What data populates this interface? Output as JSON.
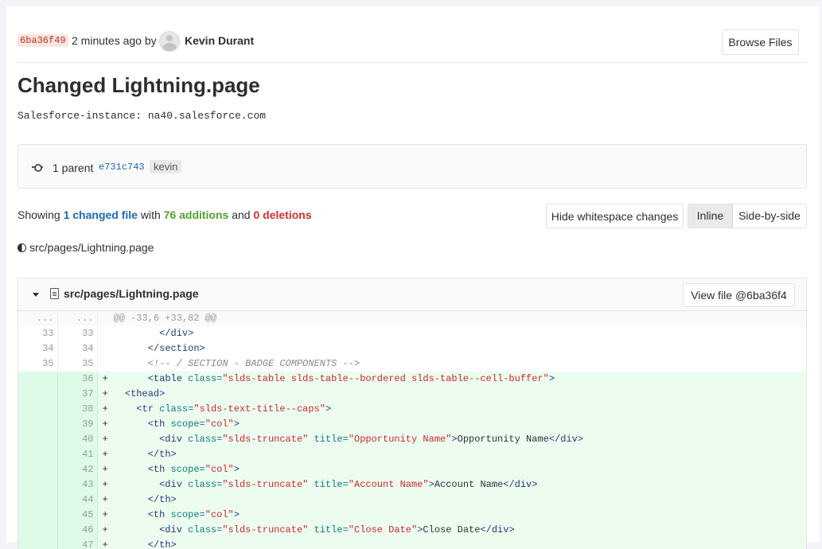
{
  "commit": {
    "sha": "6ba36f49",
    "time_text": "2 minutes ago by",
    "author": "Kevin Durant",
    "browse_label": "Browse Files",
    "title": "Changed Lightning.page",
    "description": "Salesforce-instance: na40.salesforce.com",
    "parents_text": "1 parent",
    "parent_sha": "e731c743",
    "branch": "kevin"
  },
  "summary": {
    "prefix": "Showing ",
    "changed": "1 changed file",
    "with": " with ",
    "additions": "76 additions",
    "and": " and ",
    "deletions": "0 deletions"
  },
  "toolbar": {
    "whitespace_label": "Hide whitespace changes",
    "inline_label": "Inline",
    "side_label": "Side-by-side"
  },
  "file_tree": {
    "path": "src/pages/Lightning.page"
  },
  "diff_file": {
    "name": "src/pages/Lightning.page",
    "view_label": "View file @6ba36f4",
    "hunk_header": "@@ -33,6 +33,82 @@",
    "hunk_ellipsis": "...",
    "lines": [
      {
        "old": "33",
        "new": "33",
        "sign": "",
        "type": "ctx",
        "tokens": [
          [
            "txt",
            "        "
          ],
          [
            "tag",
            "</div>"
          ]
        ]
      },
      {
        "old": "34",
        "new": "34",
        "sign": "",
        "type": "ctx",
        "tokens": [
          [
            "txt",
            "      "
          ],
          [
            "tag",
            "</section>"
          ]
        ]
      },
      {
        "old": "35",
        "new": "35",
        "sign": "",
        "type": "ctx",
        "tokens": [
          [
            "txt",
            "      "
          ],
          [
            "cmt",
            "<!-- / SECTION - BADGE COMPONENTS -->"
          ]
        ]
      },
      {
        "old": "",
        "new": "36",
        "sign": "+",
        "type": "add",
        "tokens": [
          [
            "txt",
            "      "
          ],
          [
            "tag",
            "<table "
          ],
          [
            "attr",
            "class="
          ],
          [
            "str",
            "\"slds-table slds-table--bordered slds-table--cell-buffer\""
          ],
          [
            "tag",
            ">"
          ]
        ]
      },
      {
        "old": "",
        "new": "37",
        "sign": "+",
        "type": "add",
        "tokens": [
          [
            "txt",
            "  "
          ],
          [
            "tag",
            "<thead>"
          ]
        ]
      },
      {
        "old": "",
        "new": "38",
        "sign": "+",
        "type": "add",
        "tokens": [
          [
            "txt",
            "    "
          ],
          [
            "tag",
            "<tr "
          ],
          [
            "attr",
            "class="
          ],
          [
            "str",
            "\"slds-text-title--caps\""
          ],
          [
            "tag",
            ">"
          ]
        ]
      },
      {
        "old": "",
        "new": "39",
        "sign": "+",
        "type": "add",
        "tokens": [
          [
            "txt",
            "      "
          ],
          [
            "tag",
            "<th "
          ],
          [
            "attr",
            "scope="
          ],
          [
            "str",
            "\"col\""
          ],
          [
            "tag",
            ">"
          ]
        ]
      },
      {
        "old": "",
        "new": "40",
        "sign": "+",
        "type": "add",
        "tokens": [
          [
            "txt",
            "        "
          ],
          [
            "tag",
            "<div "
          ],
          [
            "attr",
            "class="
          ],
          [
            "str",
            "\"slds-truncate\""
          ],
          [
            "txt",
            " "
          ],
          [
            "attr",
            "title="
          ],
          [
            "str",
            "\"Opportunity Name\""
          ],
          [
            "tag",
            ">"
          ],
          [
            "txt",
            "Opportunity Name"
          ],
          [
            "tag",
            "</div>"
          ]
        ]
      },
      {
        "old": "",
        "new": "41",
        "sign": "+",
        "type": "add",
        "tokens": [
          [
            "txt",
            "      "
          ],
          [
            "tag",
            "</th>"
          ]
        ]
      },
      {
        "old": "",
        "new": "42",
        "sign": "+",
        "type": "add",
        "tokens": [
          [
            "txt",
            "      "
          ],
          [
            "tag",
            "<th "
          ],
          [
            "attr",
            "scope="
          ],
          [
            "str",
            "\"col\""
          ],
          [
            "tag",
            ">"
          ]
        ]
      },
      {
        "old": "",
        "new": "43",
        "sign": "+",
        "type": "add",
        "tokens": [
          [
            "txt",
            "        "
          ],
          [
            "tag",
            "<div "
          ],
          [
            "attr",
            "class="
          ],
          [
            "str",
            "\"slds-truncate\""
          ],
          [
            "txt",
            " "
          ],
          [
            "attr",
            "title="
          ],
          [
            "str",
            "\"Account Name\""
          ],
          [
            "tag",
            ">"
          ],
          [
            "txt",
            "Account Name"
          ],
          [
            "tag",
            "</div>"
          ]
        ]
      },
      {
        "old": "",
        "new": "44",
        "sign": "+",
        "type": "add",
        "tokens": [
          [
            "txt",
            "      "
          ],
          [
            "tag",
            "</th>"
          ]
        ]
      },
      {
        "old": "",
        "new": "45",
        "sign": "+",
        "type": "add",
        "tokens": [
          [
            "txt",
            "      "
          ],
          [
            "tag",
            "<th "
          ],
          [
            "attr",
            "scope="
          ],
          [
            "str",
            "\"col\""
          ],
          [
            "tag",
            ">"
          ]
        ]
      },
      {
        "old": "",
        "new": "46",
        "sign": "+",
        "type": "add",
        "tokens": [
          [
            "txt",
            "        "
          ],
          [
            "tag",
            "<div "
          ],
          [
            "attr",
            "class="
          ],
          [
            "str",
            "\"slds-truncate\""
          ],
          [
            "txt",
            " "
          ],
          [
            "attr",
            "title="
          ],
          [
            "str",
            "\"Close Date\""
          ],
          [
            "tag",
            ">"
          ],
          [
            "txt",
            "Close Date"
          ],
          [
            "tag",
            "</div>"
          ]
        ]
      },
      {
        "old": "",
        "new": "47",
        "sign": "+",
        "type": "add",
        "tokens": [
          [
            "txt",
            "      "
          ],
          [
            "tag",
            "</th>"
          ]
        ]
      }
    ]
  }
}
